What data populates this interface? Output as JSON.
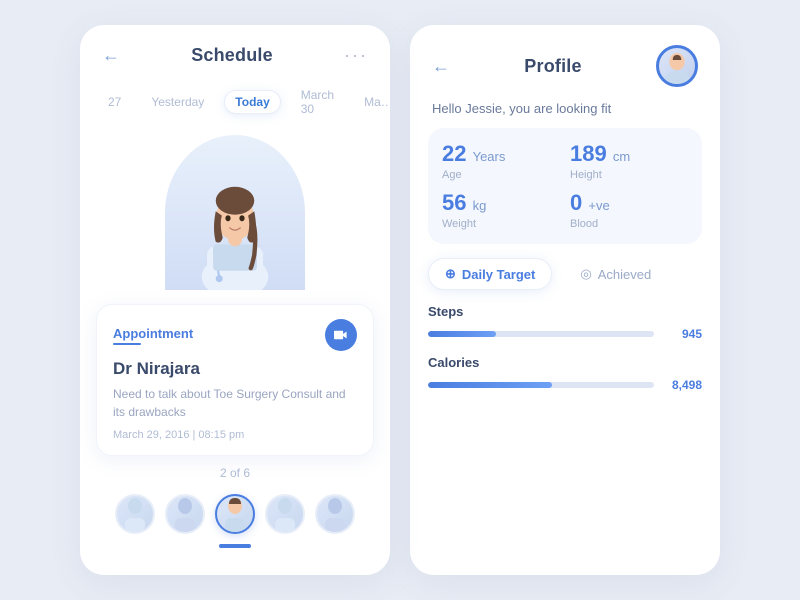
{
  "left_card": {
    "header": {
      "back_label": "←",
      "title": "Schedule",
      "more_label": "···"
    },
    "tabs": [
      {
        "label": "27",
        "active": false
      },
      {
        "label": "Yesterday",
        "active": false
      },
      {
        "label": "Today",
        "active": true
      },
      {
        "label": "March 30",
        "active": false
      },
      {
        "label": "Ma…",
        "active": false
      }
    ],
    "appointment": {
      "label": "Appointment",
      "doctor_name": "Dr Nirajara",
      "description": "Need to talk about Toe Surgery Consult and its drawbacks",
      "date": "March 29, 2016  |  08:15 pm"
    },
    "pagination": "2 of 6",
    "avatars": [
      {
        "selected": false
      },
      {
        "selected": false
      },
      {
        "selected": true
      },
      {
        "selected": false
      },
      {
        "selected": false
      }
    ]
  },
  "right_card": {
    "header": {
      "back_label": "←",
      "title": "Profile"
    },
    "greeting": "Hello Jessie, you are looking fit",
    "stats": [
      {
        "value": "22",
        "unit": "Years",
        "label": "Age"
      },
      {
        "value": "189",
        "unit": "cm",
        "label": "Height"
      },
      {
        "value": "56",
        "unit": "kg",
        "label": "Weight"
      },
      {
        "value": "0",
        "unit": "+ve",
        "label": "Blood"
      }
    ],
    "target_tabs": [
      {
        "label": "Daily Target",
        "icon": "⊕",
        "active": true
      },
      {
        "label": "Achieved",
        "icon": "◎",
        "active": false
      }
    ],
    "metrics": [
      {
        "label": "Steps",
        "value": "945",
        "percent": 30
      },
      {
        "label": "Calories",
        "value": "8,498",
        "percent": 55
      }
    ]
  }
}
